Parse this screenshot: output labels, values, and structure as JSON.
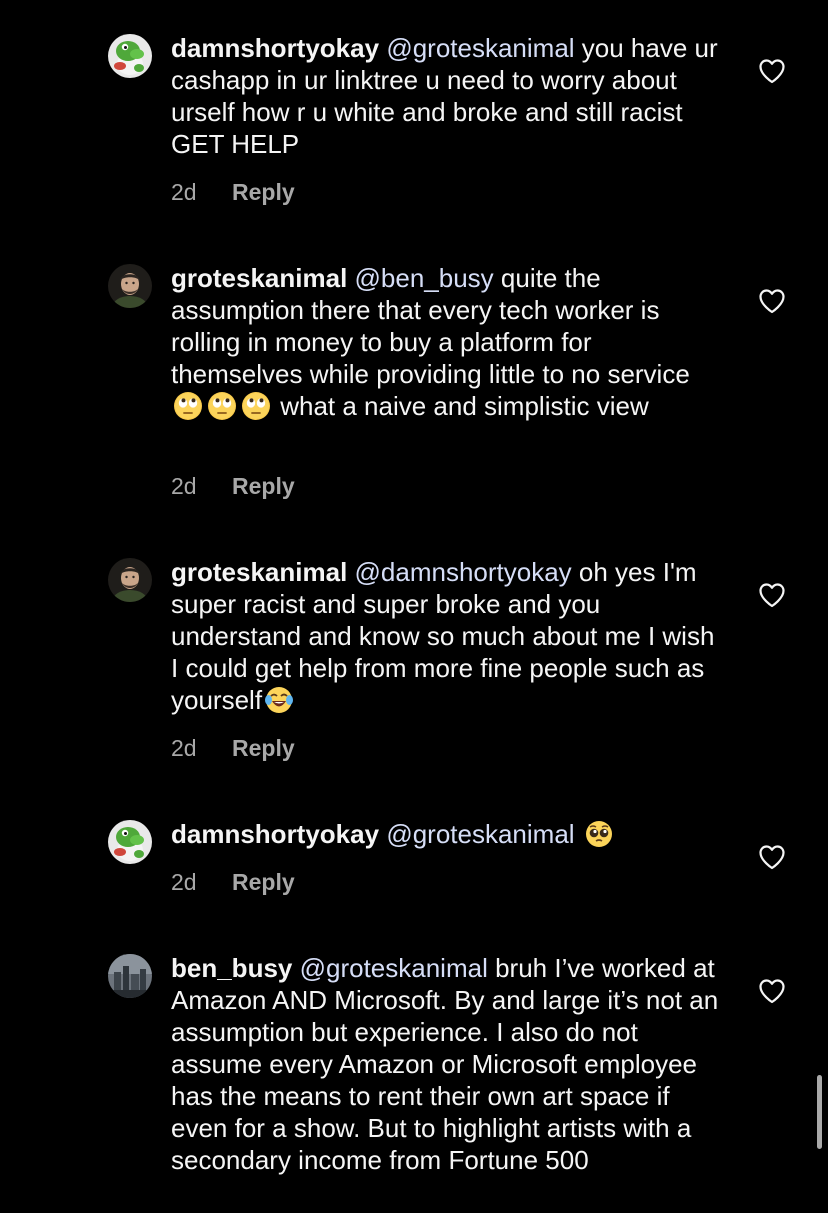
{
  "comments": [
    {
      "username": "damnshortyokay",
      "mention": "@groteskanimal",
      "text_before_emoji": " you have ur cashapp in ur linktree u need to worry about urself how r u white and broke and still racist GET HELP",
      "time": "2d",
      "reply_label": "Reply",
      "avatar": "yoshi-avatar"
    },
    {
      "username": "groteskanimal",
      "mention": "@ben_busy",
      "text_before_emoji": " quite the assumption there that every tech worker is rolling in money to buy a platform for themselves while providing little to no service ",
      "emojis": [
        "face-with-rolling-eyes-emoji",
        "face-with-rolling-eyes-emoji",
        "face-with-rolling-eyes-emoji"
      ],
      "text_after_emoji": " what a naive and simplistic view",
      "time": "2d",
      "reply_label": "Reply",
      "avatar": "man-portrait-avatar"
    },
    {
      "username": "groteskanimal",
      "mention": "@damnshortyokay",
      "text_before_emoji": " oh yes I'm super racist and super broke and you understand and know so much about me I wish I could get help from more fine people such as yourself",
      "emojis": [
        "face-with-tears-of-joy-emoji"
      ],
      "time": "2d",
      "reply_label": "Reply",
      "avatar": "man-portrait-avatar"
    },
    {
      "username": "damnshortyokay",
      "mention": "@groteskanimal",
      "text_before_emoji": " ",
      "emojis": [
        "pleading-face-emoji"
      ],
      "time": "2d",
      "reply_label": "Reply",
      "avatar": "yoshi-avatar"
    },
    {
      "username": "ben_busy",
      "mention": "@groteskanimal",
      "text_before_emoji": " bruh I’ve worked at Amazon AND Microsoft. By and large it’s not an assumption but experience. I also do not assume every Amazon or Microsoft employee has the means to rent their own art space if even for a show. But to highlight artists with a secondary income from Fortune 500",
      "avatar": "cityscape-avatar"
    }
  ],
  "colors": {
    "background": "#000000",
    "text": "#f5f5f5",
    "mention": "#d6def7",
    "meta": "#a8a8a8"
  },
  "icons": {
    "like": "heart-outline-icon"
  }
}
